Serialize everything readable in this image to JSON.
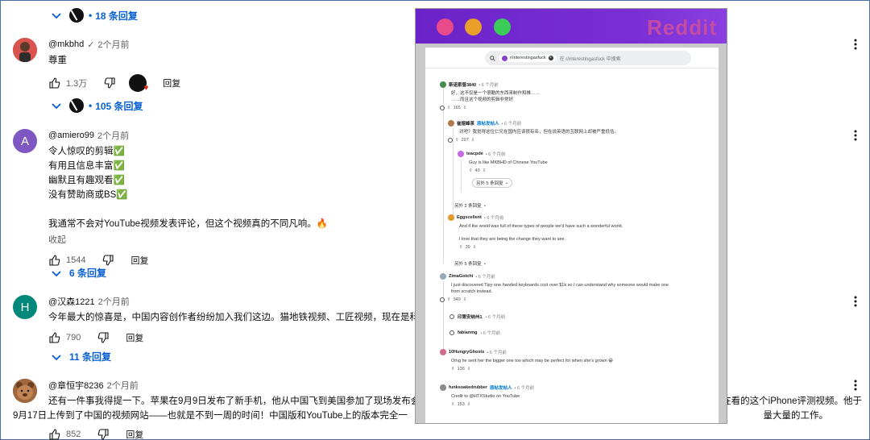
{
  "youtube": {
    "replies_toggles": [
      {
        "label": "18 条回复"
      },
      {
        "label": "105 条回复"
      },
      {
        "label": "6 条回复"
      },
      {
        "label": "11 条回复"
      }
    ],
    "comments": [
      {
        "handle": "@mkbhd",
        "verified": "✓",
        "time": "2个月前",
        "text": "尊重",
        "likes": "1.3万",
        "reply_label": "回复",
        "avatar_color": "#c0392b"
      },
      {
        "handle": "@amiero99",
        "time": "2个月前",
        "text": "令人惊叹的剪辑✅\n有用且信息丰富✅\n幽默且有趣观看✅\n没有赞助商或BS✅\n\n我通常不会对YouTube视频发表评论，但这个视频真的不同凡响。🔥",
        "read_less": "收起",
        "likes": "1544",
        "reply_label": "回复",
        "avatar_letter": "A",
        "avatar_color": "#7e57c2"
      },
      {
        "handle": "@汉森1221",
        "time": "2个月前",
        "text": "今年最大的惊喜是，中国内容创作者纷纷加入我们这边。猫地铁视频、工匠视频，现在是科技频",
        "likes": "790",
        "reply_label": "回复",
        "avatar_letter": "H",
        "avatar_color": "#00897b"
      },
      {
        "handle": "@章恒宇8236",
        "time": "2个月前",
        "text_line1": "还有一件事我得提一下。苹果在9月9日发布了新手机，他从中国飞到美国参加了现场发布会，在",
        "text_line1_tail": "全正在看的这个iPhone评测视频。他于",
        "text_line2": "9月17日上传到了中国的视频网站——也就是不到一周的时间！中国版和YouTube上的版本完全一",
        "text_line2_tail": "量大量的工作。",
        "likes": "852",
        "reply_label": "回复",
        "avatar_color": "#8d5a3b"
      }
    ]
  },
  "reddit": {
    "brand": "Reddit",
    "traffic_colors": [
      "#e94b8a",
      "#e8a02b",
      "#3ccc5a"
    ],
    "search": {
      "chip": "r/interestingasfuck",
      "placeholder": "在 r/interestingasfuck 中搜索"
    },
    "comments": [
      {
        "user": "斯诺索普3840",
        "time": "• 6 个月前",
        "body": "好，这不仅是一个很酷的东西来制作和推……\n……而且这个视频的剪辑非常好",
        "votes": "165"
      },
      {
        "user": "崔煜峰茶",
        "op": "原帖发帖人",
        "time": "• 6 个月前",
        "body": "对吧？我觉得这位仁兄在国内应该很有名，但在说英语的互联网上却被严重低估。",
        "votes": "297"
      },
      {
        "user": "teacpde",
        "time": "• 6 个月前",
        "body": "Guy is like MKBHD of Chinese YouTube",
        "votes": "43"
      },
      {
        "more": "另外 5 条回复"
      },
      {
        "more": "另外 2 条回复"
      },
      {
        "user": "Eggscellent",
        "time": "• 6 个月前",
        "body": "And if the world was full of these types of people we'd have such a wonderful world.\n\nI love that they are being the change they want to see.",
        "votes": "39"
      },
      {
        "more": "另外 5 条回复"
      },
      {
        "user": "ZimaGotchi",
        "time": "• 6 个月前",
        "body": "I just discovered Tipy one handed keyboards cost over $1k so I can understand why someone would make one\nfrom scratch instead.",
        "votes": "349"
      },
      {
        "user": "印第安纳州1",
        "time": "• 6 个月前"
      },
      {
        "user": "fabianmg",
        "time": "• 6 个月前"
      },
      {
        "user": "10HungryGhosts",
        "time": "• 6 个月前",
        "body": "Omg he sent her the bigger one too which may be perfect for when she's grown 😁",
        "votes": "136"
      },
      {
        "user": "funksoakedrubber",
        "op": "原帖发帖人",
        "time": "• 6 个月前",
        "body": "Credit to @HTXStudio on YouTube",
        "votes": "153"
      }
    ]
  }
}
